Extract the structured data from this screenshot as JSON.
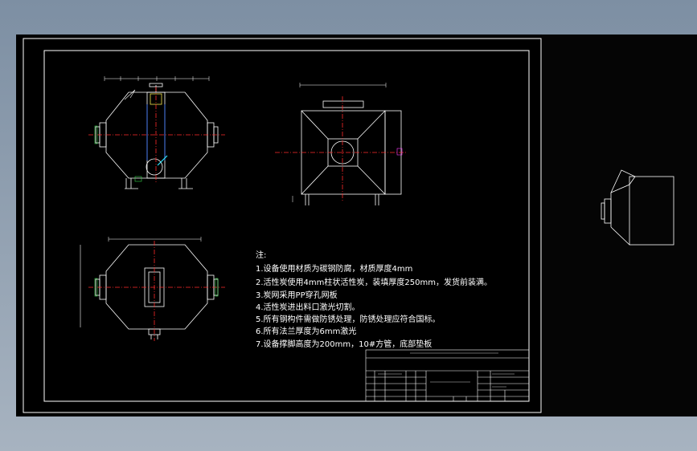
{
  "notes": {
    "heading": "注:",
    "items": [
      "1.设备使用材质为碳钢防腐，材质厚度4mm",
      "2.活性炭使用4mm柱状活性炭，装填厚度250mm，发货前装满。",
      "3.炭网采用PP穿孔网板",
      "4.活性炭进出料口激光切割。",
      "5.所有钢构件需做防锈处理，防锈处理应符合国标。",
      "6.所有法兰厚度为6mm激光",
      "7.设备撑脚高度为200mm，10#方管，底部垫板"
    ]
  },
  "colors": {
    "paper": "#000000",
    "line": "#ffffff",
    "center": "#ff2a2a",
    "part": "#2e6bff",
    "cyan": "#2ee6ff",
    "magenta": "#ff3cff",
    "green": "#37d24a",
    "yellow": "#f0e24a"
  }
}
